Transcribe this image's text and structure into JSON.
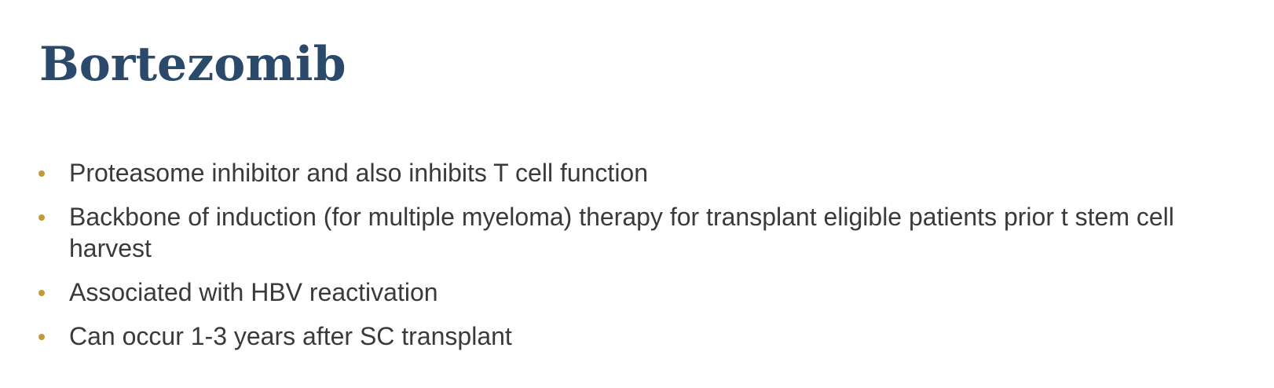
{
  "slide": {
    "title": "Bortezomib",
    "accent_color": "#c49a3a",
    "title_color": "#2b4a6b",
    "bullets": [
      {
        "text": "Proteasome inhibitor and also inhibits T cell function"
      },
      {
        "text": "Backbone of induction (for multiple myeloma) therapy for transplant eligible patients prior t stem cell harvest"
      },
      {
        "text": "Associated with HBV reactivation"
      },
      {
        "text": "Can occur 1-3 years after SC transplant"
      }
    ]
  }
}
